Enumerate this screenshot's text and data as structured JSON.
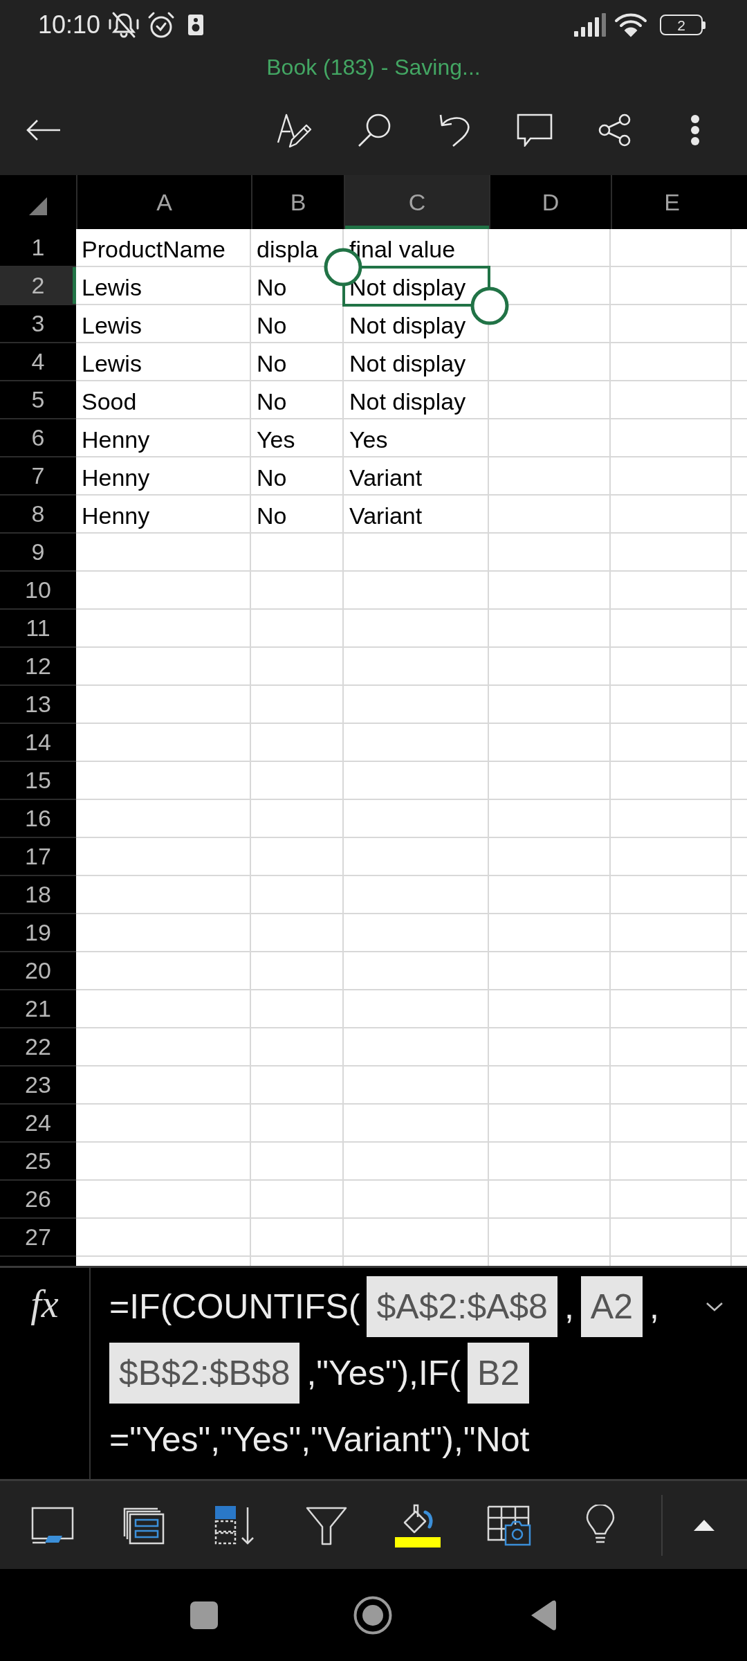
{
  "status_bar": {
    "time": "10:10",
    "battery": "2"
  },
  "header": {
    "title": "Book (183) - Saving..."
  },
  "sheet": {
    "columns": [
      {
        "label": "A",
        "selected": false
      },
      {
        "label": "B",
        "selected": false
      },
      {
        "label": "C",
        "selected": true
      },
      {
        "label": "D",
        "selected": false
      },
      {
        "label": "E",
        "selected": false
      }
    ],
    "rows": [
      {
        "number": "1",
        "selected": false,
        "cells": [
          "ProductName",
          "displa",
          "final value"
        ]
      },
      {
        "number": "2",
        "selected": true,
        "cells": [
          "Lewis",
          "No",
          "Not display"
        ]
      },
      {
        "number": "3",
        "selected": false,
        "cells": [
          "Lewis",
          "No",
          "Not display"
        ]
      },
      {
        "number": "4",
        "selected": false,
        "cells": [
          "Lewis",
          "No",
          "Not display"
        ]
      },
      {
        "number": "5",
        "selected": false,
        "cells": [
          "Sood",
          "No",
          "Not display"
        ]
      },
      {
        "number": "6",
        "selected": false,
        "cells": [
          "Henny",
          "Yes",
          "Yes"
        ]
      },
      {
        "number": "7",
        "selected": false,
        "cells": [
          "Henny",
          "No",
          "Variant"
        ]
      },
      {
        "number": "8",
        "selected": false,
        "cells": [
          "Henny",
          "No",
          "Variant"
        ]
      },
      {
        "number": "9",
        "selected": false
      },
      {
        "number": "10",
        "selected": false
      },
      {
        "number": "11",
        "selected": false
      },
      {
        "number": "12",
        "selected": false
      },
      {
        "number": "13",
        "selected": false
      },
      {
        "number": "14",
        "selected": false
      },
      {
        "number": "15",
        "selected": false
      },
      {
        "number": "16",
        "selected": false
      },
      {
        "number": "17",
        "selected": false
      },
      {
        "number": "18",
        "selected": false
      },
      {
        "number": "19",
        "selected": false
      },
      {
        "number": "20",
        "selected": false
      },
      {
        "number": "21",
        "selected": false
      },
      {
        "number": "22",
        "selected": false
      },
      {
        "number": "23",
        "selected": false
      },
      {
        "number": "24",
        "selected": false
      },
      {
        "number": "25",
        "selected": false
      },
      {
        "number": "26",
        "selected": false
      },
      {
        "number": "27",
        "selected": false
      }
    ]
  },
  "formula_bar": {
    "label": "fx",
    "lines": [
      [
        {
          "kind": "text",
          "text": "=IF(COUNTIFS("
        },
        {
          "kind": "ref",
          "text": "$A$2:$A$8"
        },
        {
          "kind": "text",
          "text": ","
        },
        {
          "kind": "ref",
          "text": "A2"
        },
        {
          "kind": "text",
          "text": ","
        }
      ],
      [
        {
          "kind": "ref",
          "text": "$B$2:$B$8"
        },
        {
          "kind": "text",
          "text": ",\"Yes\"),IF("
        },
        {
          "kind": "ref",
          "text": "B2"
        }
      ],
      [
        {
          "kind": "text",
          "text": "=\"Yes\",\"Yes\",\"Variant\"),\"Not"
        }
      ]
    ]
  }
}
